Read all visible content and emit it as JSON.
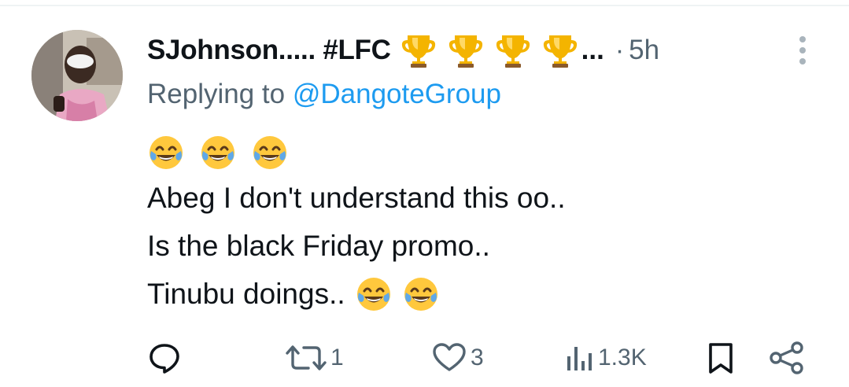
{
  "tweet": {
    "author": {
      "display_name": "SJohnson..... #LFC",
      "trophy_icon": "trophy-icon",
      "trophy_count": 4,
      "name_truncation": "...",
      "separator": "·",
      "time": "5h"
    },
    "reply_prefix": "Replying to",
    "reply_handle": "@DangoteGroup",
    "body": {
      "emoji_line_icon": "face-with-tears-of-joy-icon",
      "emoji_line_count": 3,
      "line1": "Abeg I don't understand this oo..",
      "line2": "Is the black Friday promo..",
      "line3": "Tinubu doings..",
      "line3_emoji_count": 2
    },
    "actions": {
      "reply": {
        "icon": "reply-icon",
        "count": ""
      },
      "retweet": {
        "icon": "retweet-icon",
        "count": "1"
      },
      "like": {
        "icon": "heart-icon",
        "count": "3"
      },
      "views": {
        "icon": "views-icon",
        "count": "1.3K"
      },
      "bookmark": {
        "icon": "bookmark-icon",
        "count": ""
      },
      "share": {
        "icon": "share-icon",
        "count": ""
      }
    }
  },
  "colors": {
    "text_primary": "#0f1419",
    "text_secondary": "#536471",
    "link": "#1d9bf0",
    "trophy_gold": "#f4b400",
    "emoji_yellow": "#ffc83d",
    "tear_blue": "#5fa8e8"
  }
}
